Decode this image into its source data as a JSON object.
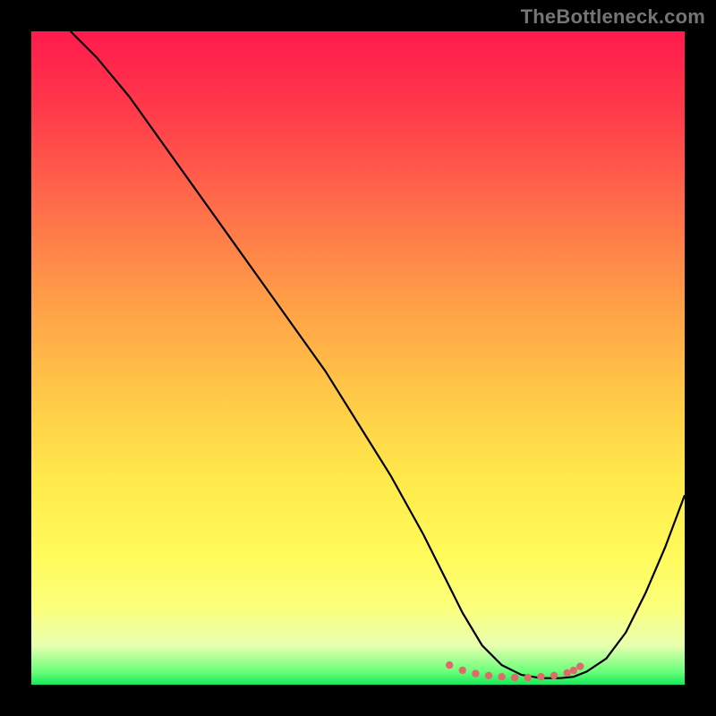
{
  "watermark": "TheBottleneck.com",
  "chart_data": {
    "type": "line",
    "title": "",
    "xlabel": "",
    "ylabel": "",
    "xlim": [
      0,
      100
    ],
    "ylim": [
      0,
      100
    ],
    "series": [
      {
        "name": "curve",
        "x": [
          6,
          10,
          15,
          20,
          25,
          30,
          35,
          40,
          45,
          50,
          55,
          60,
          63,
          66,
          69,
          72,
          75,
          78,
          81,
          83,
          85,
          88,
          91,
          94,
          97,
          100
        ],
        "y": [
          100,
          96,
          90,
          83,
          76,
          69,
          62,
          55,
          48,
          40,
          32,
          23,
          17,
          11,
          6,
          3,
          1.5,
          1,
          1,
          1.2,
          2,
          4,
          8,
          14,
          21,
          29
        ]
      }
    ],
    "flat_region_dots": {
      "x": [
        64,
        66,
        68,
        70,
        72,
        74,
        76,
        78,
        80,
        82,
        83,
        84
      ],
      "y": [
        3.0,
        2.2,
        1.7,
        1.4,
        1.2,
        1.1,
        1.1,
        1.2,
        1.4,
        1.8,
        2.2,
        2.8
      ]
    },
    "colors": {
      "curve": "#000000",
      "dots": "#e06a6a",
      "watermark": "#757575",
      "gradient_top": "#ff1a4d",
      "gradient_bottom": "#15e85a"
    }
  }
}
